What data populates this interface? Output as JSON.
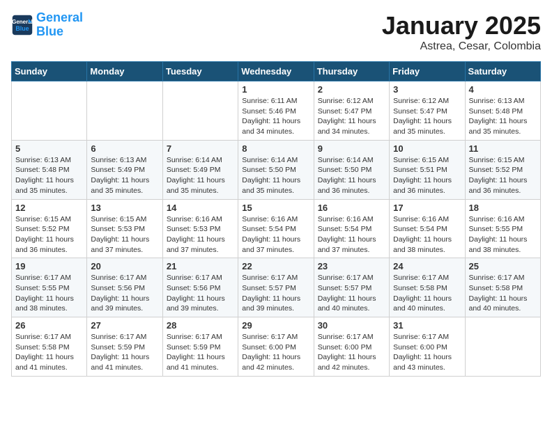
{
  "header": {
    "logo_line1": "General",
    "logo_line2": "Blue",
    "month": "January 2025",
    "location": "Astrea, Cesar, Colombia"
  },
  "weekdays": [
    "Sunday",
    "Monday",
    "Tuesday",
    "Wednesday",
    "Thursday",
    "Friday",
    "Saturday"
  ],
  "weeks": [
    [
      {
        "day": "",
        "info": ""
      },
      {
        "day": "",
        "info": ""
      },
      {
        "day": "",
        "info": ""
      },
      {
        "day": "1",
        "info": "Sunrise: 6:11 AM\nSunset: 5:46 PM\nDaylight: 11 hours\nand 34 minutes."
      },
      {
        "day": "2",
        "info": "Sunrise: 6:12 AM\nSunset: 5:47 PM\nDaylight: 11 hours\nand 34 minutes."
      },
      {
        "day": "3",
        "info": "Sunrise: 6:12 AM\nSunset: 5:47 PM\nDaylight: 11 hours\nand 35 minutes."
      },
      {
        "day": "4",
        "info": "Sunrise: 6:13 AM\nSunset: 5:48 PM\nDaylight: 11 hours\nand 35 minutes."
      }
    ],
    [
      {
        "day": "5",
        "info": "Sunrise: 6:13 AM\nSunset: 5:48 PM\nDaylight: 11 hours\nand 35 minutes."
      },
      {
        "day": "6",
        "info": "Sunrise: 6:13 AM\nSunset: 5:49 PM\nDaylight: 11 hours\nand 35 minutes."
      },
      {
        "day": "7",
        "info": "Sunrise: 6:14 AM\nSunset: 5:49 PM\nDaylight: 11 hours\nand 35 minutes."
      },
      {
        "day": "8",
        "info": "Sunrise: 6:14 AM\nSunset: 5:50 PM\nDaylight: 11 hours\nand 35 minutes."
      },
      {
        "day": "9",
        "info": "Sunrise: 6:14 AM\nSunset: 5:50 PM\nDaylight: 11 hours\nand 36 minutes."
      },
      {
        "day": "10",
        "info": "Sunrise: 6:15 AM\nSunset: 5:51 PM\nDaylight: 11 hours\nand 36 minutes."
      },
      {
        "day": "11",
        "info": "Sunrise: 6:15 AM\nSunset: 5:52 PM\nDaylight: 11 hours\nand 36 minutes."
      }
    ],
    [
      {
        "day": "12",
        "info": "Sunrise: 6:15 AM\nSunset: 5:52 PM\nDaylight: 11 hours\nand 36 minutes."
      },
      {
        "day": "13",
        "info": "Sunrise: 6:15 AM\nSunset: 5:53 PM\nDaylight: 11 hours\nand 37 minutes."
      },
      {
        "day": "14",
        "info": "Sunrise: 6:16 AM\nSunset: 5:53 PM\nDaylight: 11 hours\nand 37 minutes."
      },
      {
        "day": "15",
        "info": "Sunrise: 6:16 AM\nSunset: 5:54 PM\nDaylight: 11 hours\nand 37 minutes."
      },
      {
        "day": "16",
        "info": "Sunrise: 6:16 AM\nSunset: 5:54 PM\nDaylight: 11 hours\nand 37 minutes."
      },
      {
        "day": "17",
        "info": "Sunrise: 6:16 AM\nSunset: 5:54 PM\nDaylight: 11 hours\nand 38 minutes."
      },
      {
        "day": "18",
        "info": "Sunrise: 6:16 AM\nSunset: 5:55 PM\nDaylight: 11 hours\nand 38 minutes."
      }
    ],
    [
      {
        "day": "19",
        "info": "Sunrise: 6:17 AM\nSunset: 5:55 PM\nDaylight: 11 hours\nand 38 minutes."
      },
      {
        "day": "20",
        "info": "Sunrise: 6:17 AM\nSunset: 5:56 PM\nDaylight: 11 hours\nand 39 minutes."
      },
      {
        "day": "21",
        "info": "Sunrise: 6:17 AM\nSunset: 5:56 PM\nDaylight: 11 hours\nand 39 minutes."
      },
      {
        "day": "22",
        "info": "Sunrise: 6:17 AM\nSunset: 5:57 PM\nDaylight: 11 hours\nand 39 minutes."
      },
      {
        "day": "23",
        "info": "Sunrise: 6:17 AM\nSunset: 5:57 PM\nDaylight: 11 hours\nand 40 minutes."
      },
      {
        "day": "24",
        "info": "Sunrise: 6:17 AM\nSunset: 5:58 PM\nDaylight: 11 hours\nand 40 minutes."
      },
      {
        "day": "25",
        "info": "Sunrise: 6:17 AM\nSunset: 5:58 PM\nDaylight: 11 hours\nand 40 minutes."
      }
    ],
    [
      {
        "day": "26",
        "info": "Sunrise: 6:17 AM\nSunset: 5:58 PM\nDaylight: 11 hours\nand 41 minutes."
      },
      {
        "day": "27",
        "info": "Sunrise: 6:17 AM\nSunset: 5:59 PM\nDaylight: 11 hours\nand 41 minutes."
      },
      {
        "day": "28",
        "info": "Sunrise: 6:17 AM\nSunset: 5:59 PM\nDaylight: 11 hours\nand 41 minutes."
      },
      {
        "day": "29",
        "info": "Sunrise: 6:17 AM\nSunset: 6:00 PM\nDaylight: 11 hours\nand 42 minutes."
      },
      {
        "day": "30",
        "info": "Sunrise: 6:17 AM\nSunset: 6:00 PM\nDaylight: 11 hours\nand 42 minutes."
      },
      {
        "day": "31",
        "info": "Sunrise: 6:17 AM\nSunset: 6:00 PM\nDaylight: 11 hours\nand 43 minutes."
      },
      {
        "day": "",
        "info": ""
      }
    ]
  ]
}
